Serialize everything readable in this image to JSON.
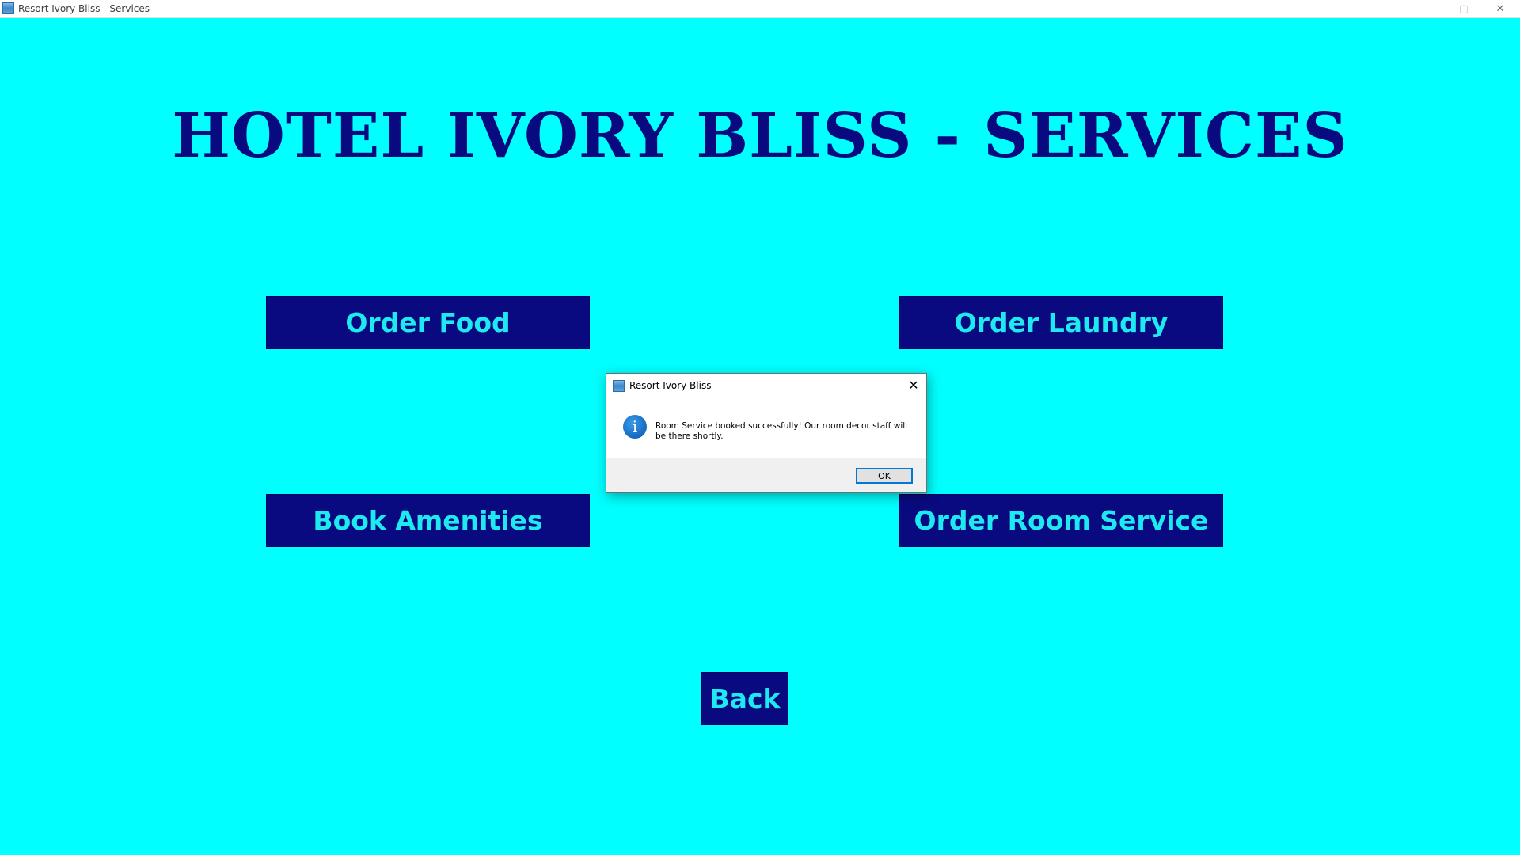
{
  "window": {
    "title": "Resort Ivory Bliss - Services",
    "controls": {
      "minimize": "—",
      "maximize": "▢",
      "close": "✕"
    }
  },
  "page": {
    "heading": "HOTEL IVORY BLISS - SERVICES"
  },
  "buttons": {
    "order_food": "Order Food",
    "order_laundry": "Order Laundry",
    "book_amenities": "Book Amenities",
    "order_room_service": "Order Room Service",
    "back": "Back"
  },
  "dialog": {
    "title": "Resort Ivory Bliss",
    "icon": "info-icon",
    "icon_glyph": "i",
    "message": "Room Service booked successfully! Our room decor staff will be there shortly.",
    "ok_label": "OK",
    "close_glyph": "✕"
  },
  "colors": {
    "background": "#00ffff",
    "button_bg": "#0a0a80",
    "button_text": "#1ee8f0",
    "heading": "#0a0a80"
  }
}
